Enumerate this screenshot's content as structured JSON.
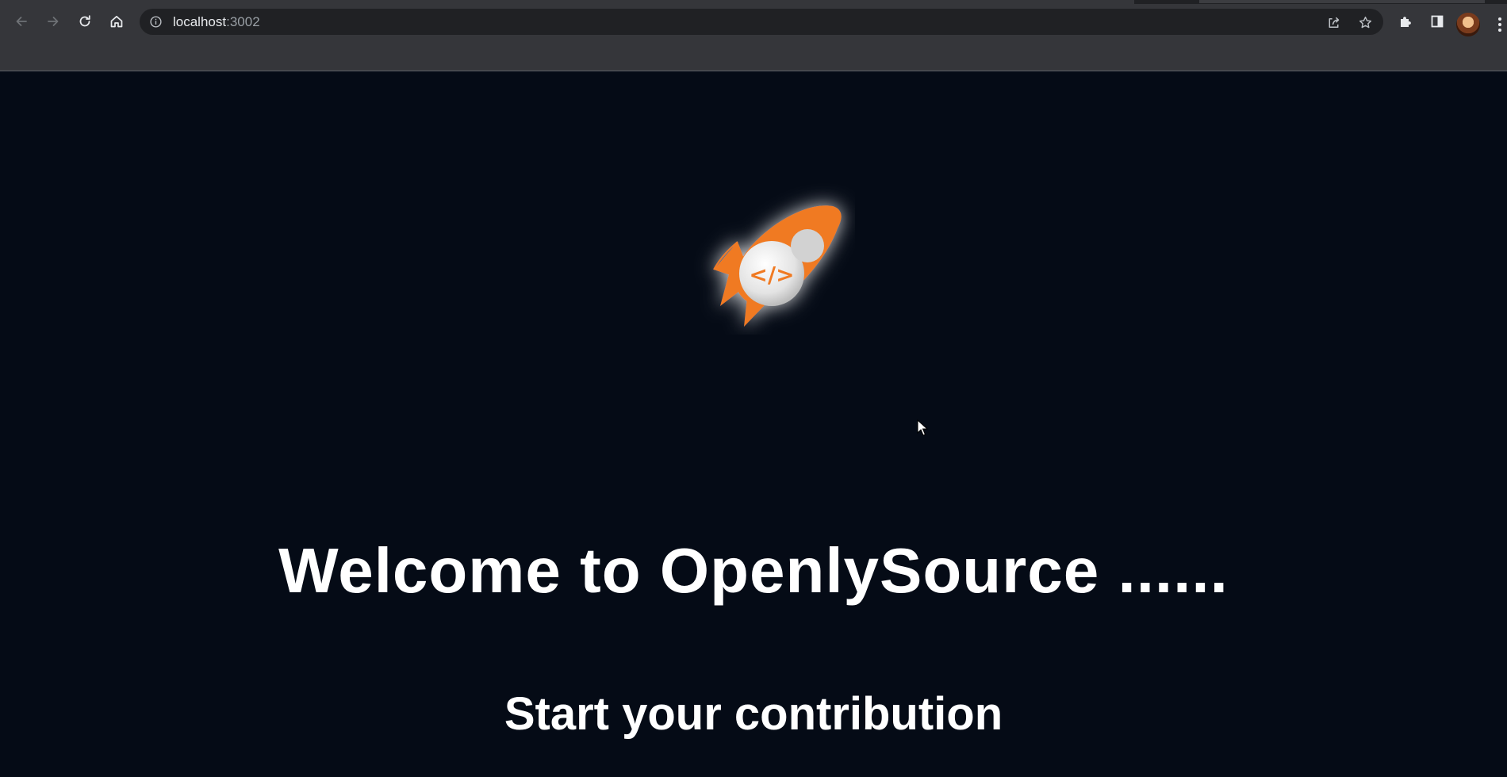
{
  "browser": {
    "url_host": "localhost",
    "url_port": ":3002",
    "icons": {
      "back": "arrow-left-icon",
      "forward": "arrow-right-icon",
      "reload": "reload-icon",
      "home": "home-icon",
      "site_info": "info-icon",
      "share": "share-icon",
      "bookmark": "star-icon",
      "extensions": "puzzle-icon",
      "side_panel": "side-panel-icon",
      "profile": "avatar",
      "menu": "kebab-menu-icon"
    }
  },
  "page": {
    "title": "Welcome to OpenlySource ......",
    "subtitle": "Start your contribution",
    "logo": {
      "icon": "rocket-logo",
      "code_glyph": "</>",
      "colors": {
        "rocket": "#f07a24",
        "window": "#e6e6e6",
        "glow": "#ffffff"
      }
    },
    "colors": {
      "background": "#050b16",
      "text": "#ffffff"
    }
  }
}
